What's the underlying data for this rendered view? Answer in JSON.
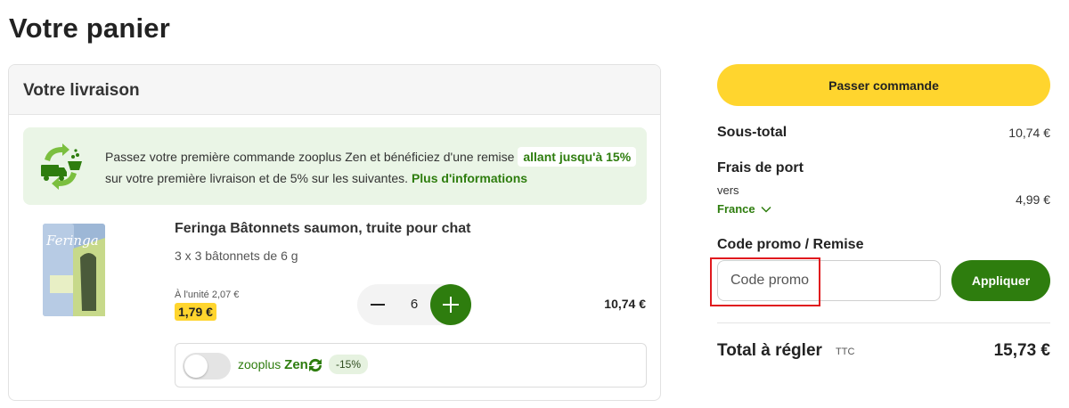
{
  "page": {
    "title": "Votre panier"
  },
  "delivery": {
    "header": "Votre livraison",
    "promo": {
      "text_before": "Passez votre première commande zooplus Zen et bénéficiez d'une remise",
      "highlight": "allant jusqu'à 15%",
      "text_after": "sur votre première livraison et de 5% sur les suivantes.",
      "link": "Plus d'informations"
    },
    "product": {
      "name": "Feringa Bâtonnets saumon, truite pour chat",
      "variant": "3 x 3 bâtonnets de 6 g",
      "unit_price": "À l'unité 2,07 €",
      "price": "1,79 €",
      "quantity": "6",
      "line_total": "10,74 €",
      "image_brand": "Feringa"
    },
    "zen": {
      "brand_prefix": "zooplus",
      "brand_suffix": "Zen",
      "discount": "-15%",
      "toggle_on": false
    }
  },
  "summary": {
    "order_button": "Passer commande",
    "subtotal_label": "Sous-total",
    "subtotal_value": "10,74 €",
    "shipping_label": "Frais de port",
    "shipping_to": "vers",
    "country": "France",
    "shipping_value": "4,99 €",
    "promo_label": "Code promo / Remise",
    "promo_placeholder": "Code promo",
    "apply_button": "Appliquer",
    "total_label": "Total à régler",
    "total_suffix": "TTC",
    "total_value": "15,73 €"
  },
  "colors": {
    "accent_green": "#2e7d0e",
    "accent_yellow": "#ffd52e",
    "banner_bg": "#eaf5e6",
    "highlight_red": "#e0191e"
  },
  "icons": {
    "promo": "delivery-truck-recycle-icon",
    "minus": "minus-icon",
    "plus": "plus-icon",
    "zen": "zen-recycle-icon",
    "chevron": "chevron-down-icon"
  }
}
